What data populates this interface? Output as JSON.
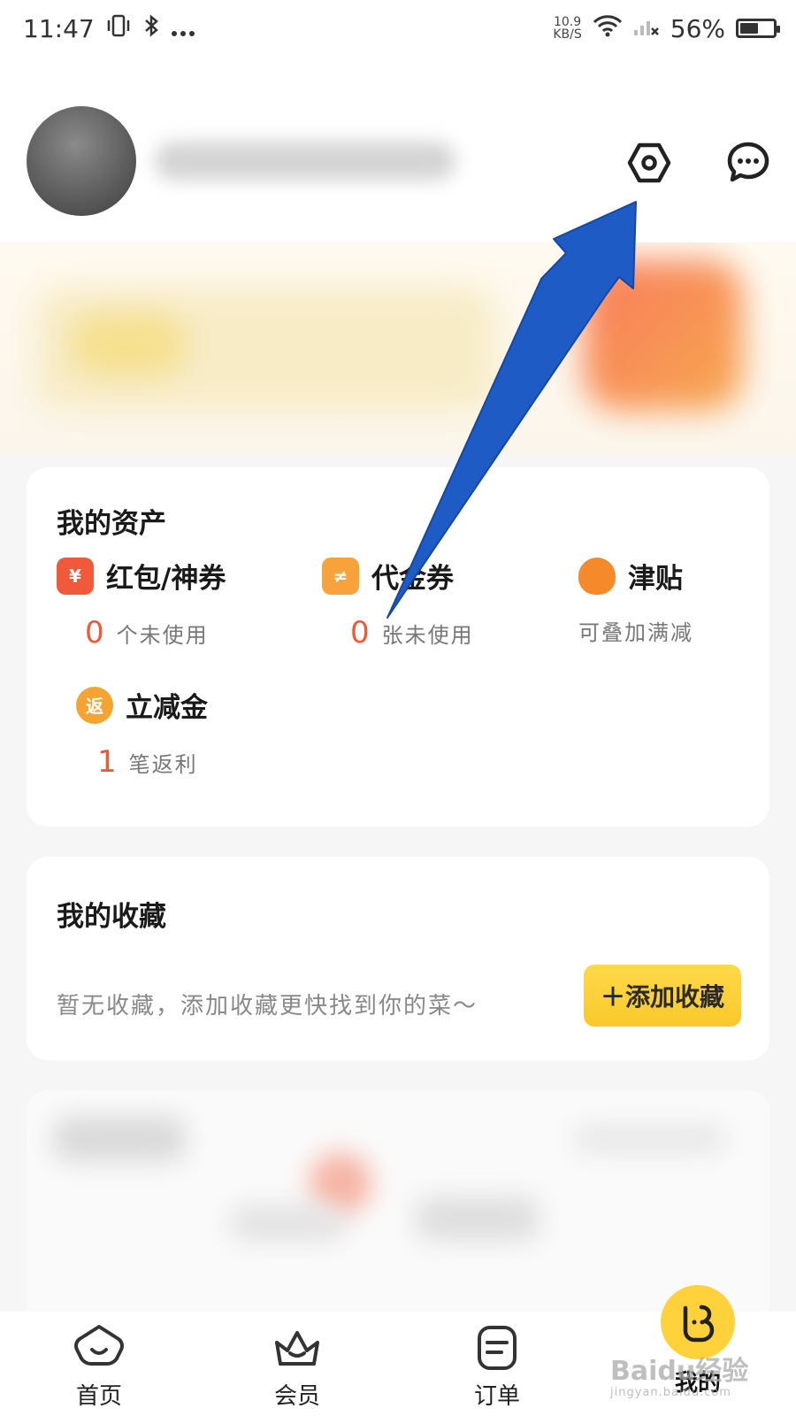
{
  "status_bar": {
    "time": "11:47",
    "net_speed_value": "10.9",
    "net_speed_unit": "KB/S",
    "battery_percent": "56%",
    "battery_level": 0.56
  },
  "header": {
    "settings_icon": "settings-hexagon-icon",
    "message_icon": "chat-bubble-icon"
  },
  "assets": {
    "title": "我的资产",
    "items": [
      {
        "label": "红包/神券",
        "count": "0",
        "desc": "个未使用",
        "icon": "red-packet-icon",
        "color": "#f05a3a"
      },
      {
        "label": "代金券",
        "count": "0",
        "desc": "张未使用",
        "icon": "voucher-icon",
        "color": "#f7a23a"
      },
      {
        "label": "津贴",
        "count": "",
        "desc": "可叠加满减",
        "icon": "money-bag-icon",
        "color": "#f58a2a"
      },
      {
        "label": "立减金",
        "count": "1",
        "desc": "笔返利",
        "icon": "rebate-icon",
        "color": "#f6a431",
        "icon_text": "返"
      }
    ]
  },
  "favorites": {
    "title": "我的收藏",
    "empty_text": "暂无收藏，添加收藏更快找到你的菜～",
    "add_button": "＋添加收藏"
  },
  "tab_bar": {
    "tabs": [
      {
        "label": "首页",
        "icon": "home-icon",
        "active": false
      },
      {
        "label": "会员",
        "icon": "member-crown-icon",
        "active": false
      },
      {
        "label": "订单",
        "icon": "order-icon",
        "active": false
      },
      {
        "label": "我的",
        "icon": "mine-icon",
        "active": true
      }
    ]
  },
  "watermark": {
    "brand": "Baidu经验",
    "site": "jingyan.baidu.com"
  },
  "colors": {
    "accent_yellow": "#ffd23c",
    "count_red": "#ec5a38",
    "annotation_arrow": "#1f5bc4"
  }
}
